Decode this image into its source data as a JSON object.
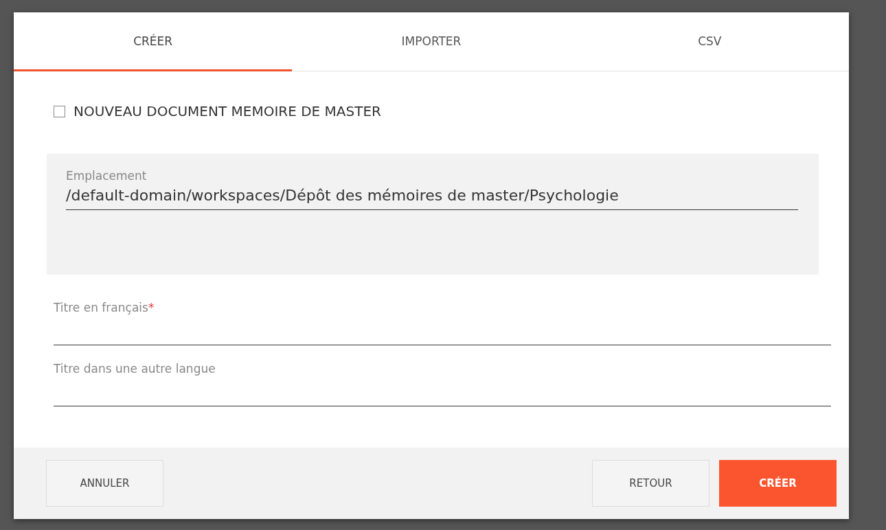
{
  "tabs": [
    {
      "label": "CRÉER",
      "selected": true
    },
    {
      "label": "IMPORTER",
      "selected": false
    },
    {
      "label": "CSV",
      "selected": false
    }
  ],
  "option": {
    "label": "NOUVEAU DOCUMENT MEMOIRE DE MASTER",
    "checked": false
  },
  "location": {
    "label": "Emplacement",
    "value": "/default-domain/workspaces/Dépôt des mémoires de master/Psychologie"
  },
  "fields": [
    {
      "label": "Titre en français",
      "required_mark": "*"
    },
    {
      "label": "Titre dans une autre langue"
    }
  ],
  "buttons": [
    {
      "label": "ANNULER",
      "kind": "secondary"
    },
    {
      "label": "RETOUR",
      "kind": "secondary"
    },
    {
      "label": "CRÉER",
      "kind": "primary"
    }
  ]
}
